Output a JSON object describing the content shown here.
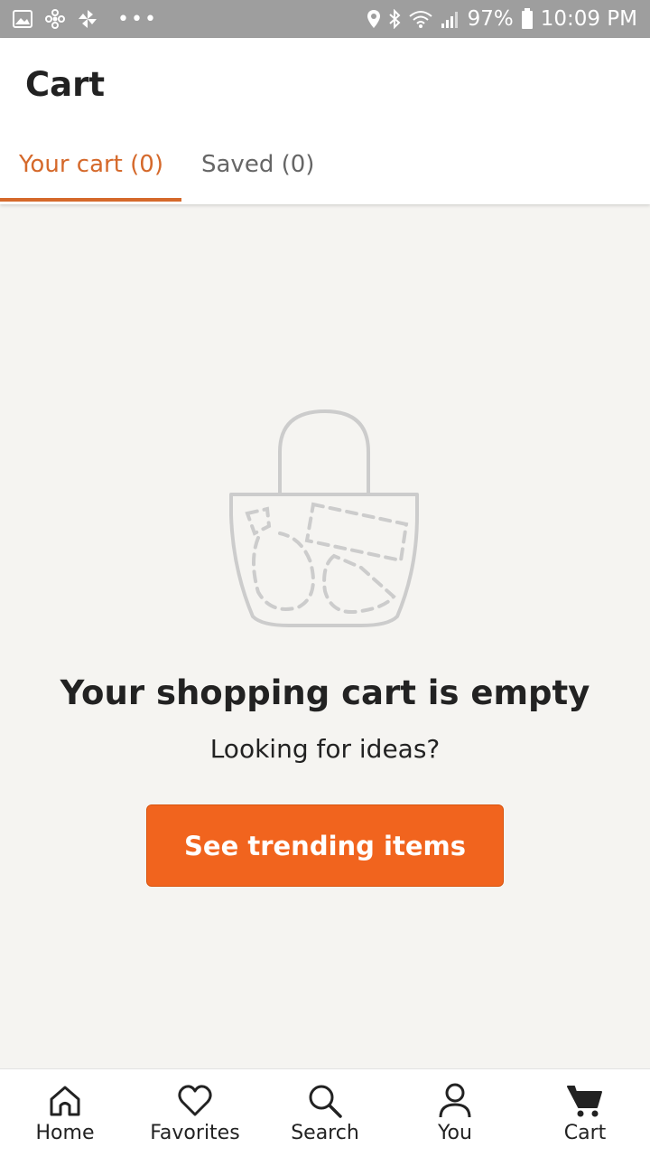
{
  "status_bar": {
    "battery": "97%",
    "time": "10:09 PM"
  },
  "header": {
    "title": "Cart",
    "tabs": [
      {
        "label": "Your cart (0)",
        "active": true
      },
      {
        "label": "Saved (0)",
        "active": false
      }
    ]
  },
  "empty_state": {
    "title": "Your shopping cart is empty",
    "subtitle": "Looking for ideas?",
    "button_label": "See trending items"
  },
  "bottom_nav": {
    "items": [
      {
        "label": "Home",
        "icon": "home-icon"
      },
      {
        "label": "Favorites",
        "icon": "heart-icon"
      },
      {
        "label": "Search",
        "icon": "search-icon"
      },
      {
        "label": "You",
        "icon": "person-icon"
      },
      {
        "label": "Cart",
        "icon": "cart-icon"
      }
    ]
  },
  "colors": {
    "accent": "#f1641e",
    "tab_active": "#d5692b",
    "background": "#f5f4f1"
  }
}
